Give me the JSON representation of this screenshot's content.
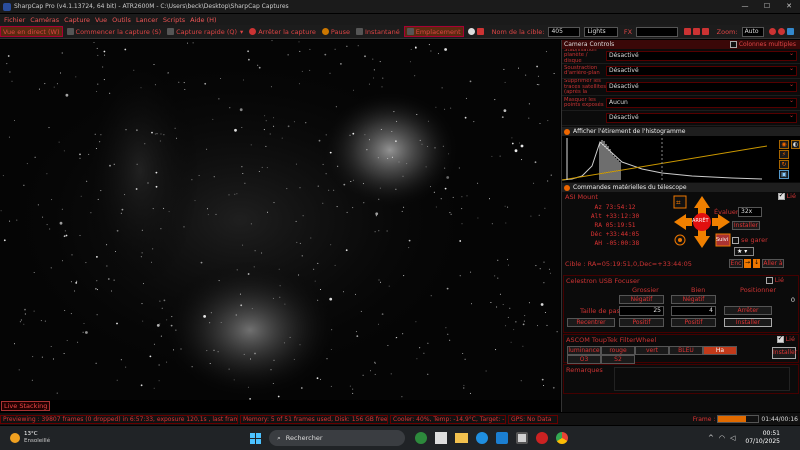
{
  "window": {
    "title": "SharpCap Pro (v4.1.13724, 64 bit) - ATR2600M - C:\\Users\\beck\\Desktop\\SharpCap Captures"
  },
  "menu": [
    "Fichier",
    "Caméras",
    "Capture",
    "Vue",
    "Outils",
    "Lancer",
    "Scripts",
    "Aide (H)"
  ],
  "toolbar": {
    "live": "Vue en direct (W)",
    "start_capture": "Commencer la capture (S)",
    "quick_capture": "Capture rapide (Q)",
    "stop_capture": "Arrêter la capture",
    "pause": "Pause",
    "snapshot": "Instantané",
    "framing": "Emplacement",
    "target_label": "Nom de la cible:",
    "target_value": "405",
    "frame_type": "Lights",
    "fx": "FX",
    "zoom_label": "Zoom:",
    "zoom_value": "Auto"
  },
  "live_stacking": "Live Stacking",
  "camera_controls": {
    "title": "Camera Controls",
    "multi_col": "Colonnes multiples",
    "rows": [
      {
        "label": "Stabilisation planète / disque",
        "value": "Désactivé"
      },
      {
        "label": "Soustraction d'arrière-plan",
        "value": "Désactivé"
      },
      {
        "label": "Supprimer les traces satellites (après la tombée de la nuit)",
        "value": "Désactivé"
      },
      {
        "label": "Masquer les points exposés",
        "value": "Aucun"
      },
      {
        "label": "",
        "value": "Désactivé"
      }
    ]
  },
  "histogram": {
    "title": "Afficher l'étirement de l'histogramme"
  },
  "telescope": {
    "title": "Commandes matérielles du télescope",
    "mount": "ASI Mount",
    "linked": "Lié",
    "az": {
      "label": "Az",
      "value": "73:54:12"
    },
    "alt": {
      "label": "Alt",
      "value": "+33:12:30"
    },
    "ra": {
      "label": "RA",
      "value": "05:19:51"
    },
    "dec": {
      "label": "Déc",
      "value": "+33:44:05"
    },
    "ah": {
      "label": "AH",
      "value": "-05:00:38"
    },
    "evaluer_label": "Évaluer:",
    "evaluer_value": "32x",
    "install": "Installer",
    "park": "se garer",
    "center_label": "ARRÊT",
    "suivi": "Suivi",
    "target_line": "Cible : RA=05:19:51,0,Dec=+33:44:05",
    "enc": "Enc",
    "goto": "Aller à"
  },
  "focuser": {
    "title": "Celestron USB Focuser",
    "linked": "Lié",
    "coarse": "Grossier",
    "fine": "Bien",
    "position_label": "Positionner",
    "position_value": "0",
    "neg1": "Négatif",
    "neg2": "Négatif",
    "step_label": "Taille de pas",
    "step_coarse": "25",
    "step_fine": "4",
    "stop": "Arrêter",
    "recenter": "Recentrer",
    "pos1": "Positif",
    "pos2": "Positif",
    "install": "Installer"
  },
  "filterwheel": {
    "title": "ASCOM ToupTek FilterWheel",
    "linked": "Lié",
    "filters": [
      "luminance",
      "rouge",
      "vert",
      "BLEU",
      "Ha",
      "O3",
      "S2"
    ],
    "active": "Ha",
    "install": "Installer"
  },
  "notes": {
    "label": "Remarques"
  },
  "status": {
    "previewing": "Previewing : 39807 frames (0 dropped) in 6:57:33, exposure 120,1s , last frame 120,1s",
    "memory": "Memory: 5 of 51 frames used, Disk: 156 GB free",
    "cooler": "Cooler: 40%, Temp: -14,9°C, Target: -15,0°",
    "gps": "GPS: No Data",
    "frame_label": "Frame :",
    "frame_time": "01:44/00:16",
    "progress": 0.7
  },
  "taskbar": {
    "weather_temp": "13°C",
    "weather_text": "Ensoleillé",
    "search": "Rechercher",
    "time": "00:51",
    "date": "07/10/2025"
  },
  "colors": {
    "accent": "#e33333",
    "panel": "#0b0b0b",
    "highlight": "#e06a00"
  }
}
